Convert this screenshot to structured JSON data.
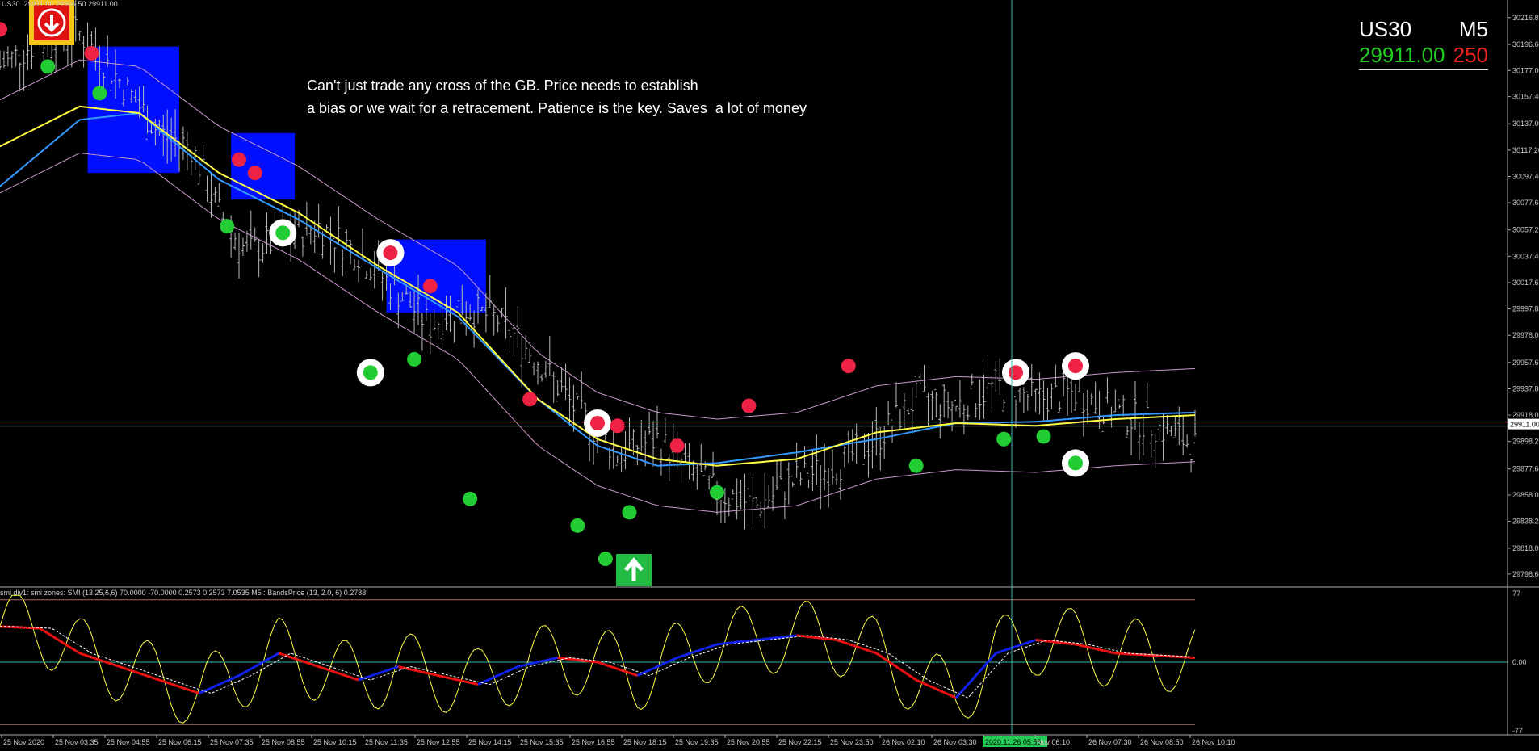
{
  "window": {
    "symbol_info": "US30",
    "ohlc": "29911.00 29906.50 29911.00"
  },
  "symbol_panel": {
    "symbol": "US30",
    "timeframe": "M5",
    "bid": "29911.00",
    "spread": "250",
    "bid_color": "#22cc22",
    "spread_color": "#ee2222"
  },
  "annotation": {
    "line1": "Can't just trade any cross of the GB. Price needs to establish",
    "line2": "a bias or we wait for a retracement. Patience is the key. Saves  a lot of money"
  },
  "indicator_header": "smi div1: smi zones: SMI (13,25,6,6) 70.0000 -70.0000 0.2573 0.2573 7.0535  M5 : BandsPrice (13, 2.0, 6) 0.2788",
  "current_price_label": "29911.00",
  "cursor_time_label": "2020.11.26 05:55",
  "colors": {
    "background": "#000000",
    "candle": "#b8b8b8",
    "ema_fast": "#3399ff",
    "ema_slow": "#ffff44",
    "bands": "#cc99cc",
    "zone": "#0010ff",
    "signal_up": "#22cc33",
    "signal_down": "#ee2244",
    "smi_up": "#1122ee",
    "smi_down": "#ee1111",
    "smi_fast": "#ffff44",
    "crosshair": "#33bbaa"
  },
  "chart_data": {
    "type": "line",
    "price_axis": {
      "ticks": [
        "30216.80",
        "30196.60",
        "30177.00",
        "30157.40",
        "30137.00",
        "30117.20",
        "30097.40",
        "30077.60",
        "30057.20",
        "30037.40",
        "30017.60",
        "29997.80",
        "29978.00",
        "29957.60",
        "29937.80",
        "29918.00",
        "29898.20",
        "29877.60",
        "29858.00",
        "29838.20",
        "29818.00",
        "29798.60"
      ],
      "ylim": [
        29790,
        30230
      ]
    },
    "indicator_axis": {
      "ticks": [
        "77",
        "0.00",
        "-77"
      ],
      "ylim": [
        -77,
        77
      ]
    },
    "time_axis": {
      "ticks": [
        "25 Nov 2020",
        "25 Nov 03:35",
        "25 Nov 04:55",
        "25 Nov 06:15",
        "25 Nov 07:35",
        "25 Nov 08:55",
        "25 Nov 10:15",
        "25 Nov 11:35",
        "25 Nov 12:55",
        "25 Nov 14:15",
        "25 Nov 15:35",
        "25 Nov 16:55",
        "25 Nov 18:15",
        "25 Nov 19:35",
        "25 Nov 20:55",
        "25 Nov 22:15",
        "25 Nov 23:50",
        "26 Nov 02:10",
        "26 Nov 03:30",
        "2020.11.26 05:55",
        "Nov 06:10",
        "26 Nov 07:30",
        "26 Nov 08:50",
        "26 Nov 10:10"
      ]
    },
    "price_path": [
      [
        0,
        30180
      ],
      [
        10,
        30200
      ],
      [
        20,
        30205
      ],
      [
        30,
        30170
      ],
      [
        40,
        30130
      ],
      [
        48,
        30120
      ],
      [
        55,
        30070
      ],
      [
        62,
        30040
      ],
      [
        70,
        30050
      ],
      [
        80,
        30060
      ],
      [
        90,
        30040
      ],
      [
        100,
        30010
      ],
      [
        108,
        29985
      ],
      [
        115,
        30000
      ],
      [
        125,
        29990
      ],
      [
        135,
        29960
      ],
      [
        145,
        29920
      ],
      [
        155,
        29890
      ],
      [
        165,
        29900
      ],
      [
        172,
        29880
      ],
      [
        180,
        29860
      ],
      [
        190,
        29850
      ],
      [
        200,
        29870
      ],
      [
        210,
        29880
      ],
      [
        220,
        29900
      ],
      [
        230,
        29930
      ],
      [
        240,
        29925
      ],
      [
        250,
        29940
      ],
      [
        260,
        29930
      ],
      [
        270,
        29935
      ],
      [
        280,
        29920
      ],
      [
        290,
        29910
      ],
      [
        300,
        29895
      ]
    ],
    "ema_slow": [
      [
        0,
        30120
      ],
      [
        20,
        30150
      ],
      [
        35,
        30145
      ],
      [
        55,
        30100
      ],
      [
        75,
        30070
      ],
      [
        95,
        30030
      ],
      [
        115,
        29995
      ],
      [
        135,
        29930
      ],
      [
        150,
        29900
      ],
      [
        165,
        29885
      ],
      [
        180,
        29880
      ],
      [
        200,
        29885
      ],
      [
        220,
        29905
      ],
      [
        240,
        29912
      ],
      [
        260,
        29910
      ],
      [
        280,
        29915
      ],
      [
        300,
        29918
      ]
    ],
    "ema_fast": [
      [
        0,
        30090
      ],
      [
        20,
        30140
      ],
      [
        35,
        30145
      ],
      [
        55,
        30095
      ],
      [
        75,
        30065
      ],
      [
        95,
        30028
      ],
      [
        115,
        29992
      ],
      [
        135,
        29930
      ],
      [
        150,
        29895
      ],
      [
        165,
        29880
      ],
      [
        180,
        29882
      ],
      [
        200,
        29890
      ],
      [
        220,
        29900
      ],
      [
        240,
        29912
      ],
      [
        260,
        29913
      ],
      [
        280,
        29918
      ],
      [
        300,
        29920
      ]
    ],
    "signals_up": [
      [
        12,
        30180
      ],
      [
        25,
        30160
      ],
      [
        57,
        30060
      ],
      [
        71,
        30055
      ],
      [
        93,
        29950
      ],
      [
        104,
        29960
      ],
      [
        118,
        29855
      ],
      [
        145,
        29835
      ],
      [
        152,
        29810
      ],
      [
        158,
        29845
      ],
      [
        180,
        29860
      ],
      [
        230,
        29880
      ],
      [
        252,
        29900
      ],
      [
        262,
        29902
      ],
      [
        270,
        29882
      ]
    ],
    "signals_down": [
      [
        0,
        30208
      ],
      [
        23,
        30190
      ],
      [
        60,
        30110
      ],
      [
        64,
        30100
      ],
      [
        98,
        30040
      ],
      [
        108,
        30015
      ],
      [
        133,
        29930
      ],
      [
        150,
        29912
      ],
      [
        155,
        29910
      ],
      [
        170,
        29895
      ],
      [
        188,
        29925
      ],
      [
        213,
        29955
      ],
      [
        255,
        29950
      ],
      [
        270,
        29955
      ]
    ],
    "zones": [
      {
        "from": 22,
        "to": 45,
        "high": 30195,
        "low": 30100
      },
      {
        "from": 58,
        "to": 74,
        "high": 30130,
        "low": 30080
      },
      {
        "from": 97,
        "to": 122,
        "high": 30050,
        "low": 29995
      }
    ],
    "current_price": 29911.0,
    "smi": [
      [
        0,
        40
      ],
      [
        10,
        38
      ],
      [
        20,
        10
      ],
      [
        30,
        -5
      ],
      [
        40,
        -20
      ],
      [
        50,
        -35
      ],
      [
        60,
        -15
      ],
      [
        70,
        10
      ],
      [
        80,
        -5
      ],
      [
        90,
        -20
      ],
      [
        100,
        -5
      ],
      [
        110,
        -15
      ],
      [
        120,
        -25
      ],
      [
        130,
        -5
      ],
      [
        140,
        5
      ],
      [
        150,
        0
      ],
      [
        160,
        -15
      ],
      [
        170,
        5
      ],
      [
        180,
        20
      ],
      [
        190,
        25
      ],
      [
        200,
        30
      ],
      [
        210,
        25
      ],
      [
        220,
        10
      ],
      [
        230,
        -20
      ],
      [
        240,
        -40
      ],
      [
        250,
        10
      ],
      [
        260,
        25
      ],
      [
        270,
        20
      ],
      [
        280,
        10
      ],
      [
        300,
        5
      ]
    ]
  }
}
